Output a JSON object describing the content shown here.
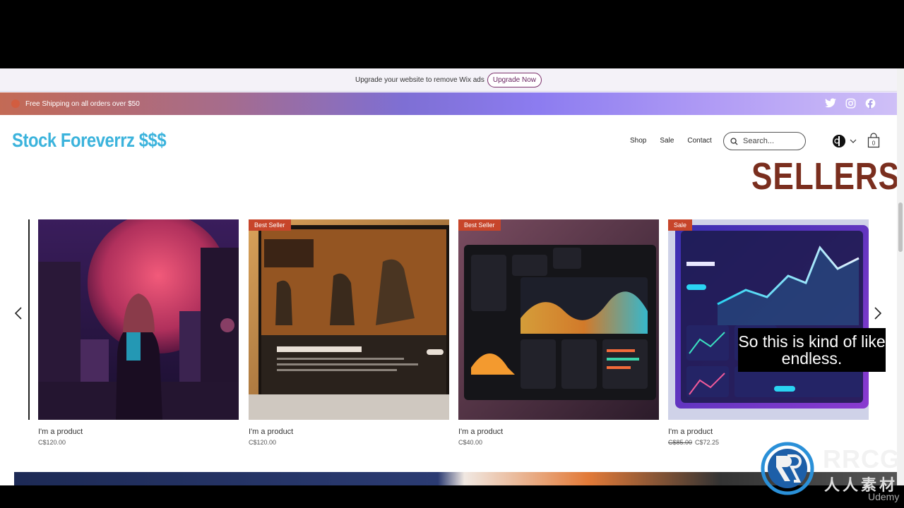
{
  "wix_bar": {
    "text": "Upgrade your website to remove Wix ads",
    "button": "Upgrade Now"
  },
  "promo": {
    "text": "Free Shipping on all orders over $50"
  },
  "social_icons": [
    "twitter-icon",
    "instagram-icon",
    "facebook-icon"
  ],
  "header": {
    "logo": "Stock Foreverrz $$$",
    "nav": [
      "Shop",
      "Sale",
      "Contact"
    ],
    "search_placeholder": "Search...",
    "cart_count": "0"
  },
  "section_heading": "SELLERS",
  "products": [
    {
      "name": "I'm a product",
      "price": "C$120.00",
      "badge": "",
      "old_price": ""
    },
    {
      "name": "I'm a product",
      "price": "C$120.00",
      "badge": "Best Seller",
      "old_price": ""
    },
    {
      "name": "I'm a product",
      "price": "C$40.00",
      "badge": "Best Seller",
      "old_price": ""
    },
    {
      "name": "I'm a product",
      "price": "C$72.25",
      "badge": "Sale",
      "old_price": "C$85.00"
    }
  ],
  "subtitle": "So this is kind of like endless.",
  "watermark": {
    "title": "RRCG",
    "sub": "人人素材"
  },
  "udemy": "Udemy",
  "colors": {
    "logo": "#3bb3dc",
    "heading": "#7a2e1e",
    "badge": "#c7452a"
  }
}
